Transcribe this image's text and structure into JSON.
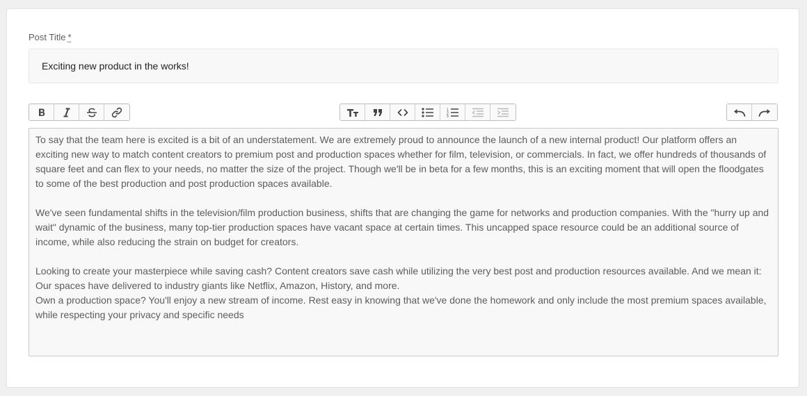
{
  "form": {
    "title_label": "Post Title",
    "required_mark": "*",
    "title_value": "Exciting new product in the works!"
  },
  "toolbar": {
    "format_icons": [
      "bold-icon",
      "italic-icon",
      "strikethrough-icon",
      "link-icon"
    ],
    "block_icons": [
      "heading-icon",
      "quote-icon",
      "code-icon",
      "bullet-list-icon",
      "numbered-list-icon",
      "outdent-icon",
      "indent-icon"
    ],
    "history_icons": [
      "undo-icon",
      "redo-icon"
    ],
    "disabled": [
      "outdent-icon",
      "indent-icon"
    ],
    "icon_color": "#444444"
  },
  "editor": {
    "paragraphs": [
      "To say that the team here is excited is a bit of an understatement. We are extremely proud to announce the launch of a new internal product! Our platform offers an exciting new way to match content creators to premium post and production spaces whether for film, television, or commercials. In fact, we offer hundreds of thousands of square feet and can flex to your needs, no matter the size of the project. Though we'll be in beta for a few months, this is an exciting moment that will open the floodgates to some of the best production and post production spaces available.",
      "We've seen fundamental shifts in the television/film production business, shifts that are changing the game for networks and production companies. With the \"hurry up and wait\" dynamic of the business, many top-tier production spaces have vacant space at certain times. This uncapped space resource could be an additional source of income, while also reducing the strain on budget for creators.",
      "Looking to create your masterpiece while saving cash? Content creators save cash while utilizing the very best post and production resources available. And we mean it: Our spaces have delivered to industry giants like Netflix, Amazon, History, and more.",
      "Own a production space? You'll enjoy a new stream of income. Rest easy in knowing that we've done the homework and only include the most premium spaces available, while respecting your privacy and specific needs"
    ]
  }
}
